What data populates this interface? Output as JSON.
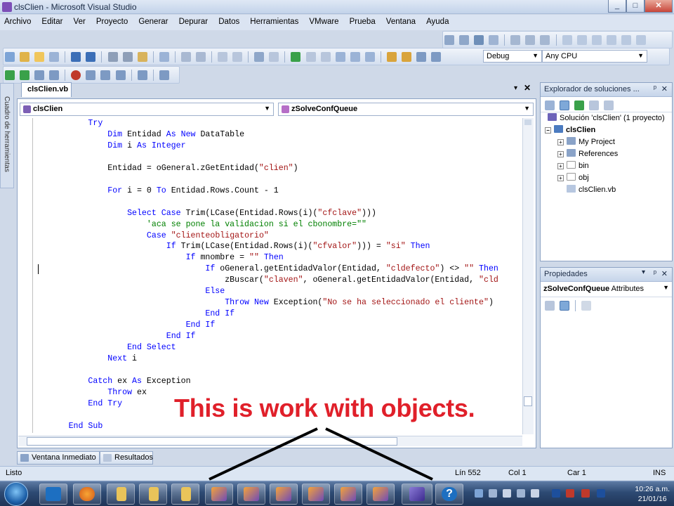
{
  "window": {
    "title": "clsClien - Microsoft Visual Studio",
    "min": "_",
    "max": "□",
    "close": "✕"
  },
  "menu": [
    "Archivo",
    "Editar",
    "Ver",
    "Proyecto",
    "Generar",
    "Depurar",
    "Datos",
    "Herramientas",
    "VMware",
    "Prueba",
    "Ventana",
    "Ayuda"
  ],
  "toolbar": {
    "config": "Debug",
    "platform": "Any CPU"
  },
  "sidestrip_label": "Cuadro de herramientas",
  "editor": {
    "tab": "clsClien.vb",
    "class_combo": "clsClien",
    "member_combo": "zSolveConfQueue",
    "lines": [
      {
        "indent": "        ",
        "parts": [
          {
            "t": "Try",
            "c": "kw"
          }
        ]
      },
      {
        "indent": "            ",
        "parts": [
          {
            "t": "Dim",
            "c": "kw"
          },
          {
            "t": " Entidad ",
            "c": ""
          },
          {
            "t": "As New",
            "c": "kw"
          },
          {
            "t": " DataTable",
            "c": ""
          }
        ]
      },
      {
        "indent": "            ",
        "parts": [
          {
            "t": "Dim",
            "c": "kw"
          },
          {
            "t": " i ",
            "c": ""
          },
          {
            "t": "As Integer",
            "c": "kw"
          }
        ]
      },
      {
        "indent": "",
        "parts": []
      },
      {
        "indent": "            ",
        "parts": [
          {
            "t": "Entidad = oGeneral.zGetEntidad(",
            "c": ""
          },
          {
            "t": "\"clien\"",
            "c": "st"
          },
          {
            "t": ")",
            "c": ""
          }
        ]
      },
      {
        "indent": "",
        "parts": []
      },
      {
        "indent": "            ",
        "parts": [
          {
            "t": "For",
            "c": "kw"
          },
          {
            "t": " i = 0 ",
            "c": ""
          },
          {
            "t": "To",
            "c": "kw"
          },
          {
            "t": " Entidad.Rows.Count - 1",
            "c": ""
          }
        ]
      },
      {
        "indent": "",
        "parts": []
      },
      {
        "indent": "                ",
        "parts": [
          {
            "t": "Select Case",
            "c": "kw"
          },
          {
            "t": " Trim(LCase(Entidad.Rows(i)(",
            "c": ""
          },
          {
            "t": "\"cfclave\"",
            "c": "st"
          },
          {
            "t": ")))",
            "c": ""
          }
        ]
      },
      {
        "indent": "                    ",
        "parts": [
          {
            "t": "'aca se pone la validacion si el cbonombre=\"\"",
            "c": "cm"
          }
        ]
      },
      {
        "indent": "                    ",
        "parts": [
          {
            "t": "Case",
            "c": "kw"
          },
          {
            "t": " ",
            "c": ""
          },
          {
            "t": "\"clienteobligatorio\"",
            "c": "st"
          }
        ]
      },
      {
        "indent": "                        ",
        "parts": [
          {
            "t": "If",
            "c": "kw"
          },
          {
            "t": " Trim(LCase(Entidad.Rows(i)(",
            "c": ""
          },
          {
            "t": "\"cfvalor\"",
            "c": "st"
          },
          {
            "t": "))) = ",
            "c": ""
          },
          {
            "t": "\"si\"",
            "c": "st"
          },
          {
            "t": " ",
            "c": ""
          },
          {
            "t": "Then",
            "c": "kw"
          }
        ]
      },
      {
        "indent": "                            ",
        "parts": [
          {
            "t": "If",
            "c": "kw"
          },
          {
            "t": " mnombre = ",
            "c": ""
          },
          {
            "t": "\"\"",
            "c": "st"
          },
          {
            "t": " ",
            "c": ""
          },
          {
            "t": "Then",
            "c": "kw"
          }
        ]
      },
      {
        "indent": "                                ",
        "parts": [
          {
            "t": "If",
            "c": "kw"
          },
          {
            "t": " oGeneral.getEntidadValor(Entidad, ",
            "c": ""
          },
          {
            "t": "\"cldefecto\"",
            "c": "st"
          },
          {
            "t": ") <> ",
            "c": ""
          },
          {
            "t": "\"\"",
            "c": "st"
          },
          {
            "t": " ",
            "c": ""
          },
          {
            "t": "Then",
            "c": "kw"
          }
        ]
      },
      {
        "indent": "                                    ",
        "parts": [
          {
            "t": "zBuscar(",
            "c": ""
          },
          {
            "t": "\"claven\"",
            "c": "st"
          },
          {
            "t": ", oGeneral.getEntidadValor(Entidad, ",
            "c": ""
          },
          {
            "t": "\"cld",
            "c": "st"
          }
        ]
      },
      {
        "indent": "                                ",
        "parts": [
          {
            "t": "Else",
            "c": "kw"
          }
        ]
      },
      {
        "indent": "                                    ",
        "parts": [
          {
            "t": "Throw New",
            "c": "kw"
          },
          {
            "t": " Exception(",
            "c": ""
          },
          {
            "t": "\"No se ha seleccionado el cliente\"",
            "c": "st"
          },
          {
            "t": ")",
            "c": ""
          }
        ]
      },
      {
        "indent": "                                ",
        "parts": [
          {
            "t": "End If",
            "c": "kw"
          }
        ]
      },
      {
        "indent": "                            ",
        "parts": [
          {
            "t": "End If",
            "c": "kw"
          }
        ]
      },
      {
        "indent": "                        ",
        "parts": [
          {
            "t": "End If",
            "c": "kw"
          }
        ]
      },
      {
        "indent": "                ",
        "parts": [
          {
            "t": "End Select",
            "c": "kw"
          }
        ]
      },
      {
        "indent": "            ",
        "parts": [
          {
            "t": "Next",
            "c": "kw"
          },
          {
            "t": " i",
            "c": ""
          }
        ]
      },
      {
        "indent": "",
        "parts": []
      },
      {
        "indent": "        ",
        "parts": [
          {
            "t": "Catch",
            "c": "kw"
          },
          {
            "t": " ex ",
            "c": ""
          },
          {
            "t": "As",
            "c": "kw"
          },
          {
            "t": " Exception",
            "c": ""
          }
        ]
      },
      {
        "indent": "            ",
        "parts": [
          {
            "t": "Throw",
            "c": "kw"
          },
          {
            "t": " ex",
            "c": ""
          }
        ]
      },
      {
        "indent": "        ",
        "parts": [
          {
            "t": "End Try",
            "c": "kw"
          }
        ]
      },
      {
        "indent": "",
        "parts": []
      },
      {
        "indent": "    ",
        "parts": [
          {
            "t": "End Sub",
            "c": "kw"
          }
        ]
      }
    ]
  },
  "solution_explorer": {
    "title": "Explorador de soluciones ...",
    "pin": "ᵖ",
    "close": "✕",
    "solution": "Solución 'clsClien' (1 proyecto)",
    "project": "clsClien",
    "items": [
      "My Project",
      "References",
      "bin",
      "obj",
      "clsClien.vb"
    ]
  },
  "properties": {
    "title": "Propiedades",
    "object": "zSolveConfQueue",
    "object_type": "Attributes"
  },
  "bottom_tabs": [
    "Ventana Inmediato",
    "Resultados"
  ],
  "status": {
    "state": "Listo",
    "line": "Lín 552",
    "col": "Col 1",
    "char": "Car 1",
    "mode": "INS"
  },
  "annotation": "This is work with objects.",
  "clock": {
    "time": "10:26 a.m.",
    "date": "21/01/16"
  },
  "colors": {
    "keyword": "#0000ff",
    "string": "#a31515",
    "comment": "#008000",
    "annotation": "#e0202a"
  },
  "icons": [
    "windows-start-icon",
    "hyper-v-icon",
    "firefox-icon",
    "folder-icon",
    "visual-studio-icon",
    "help-icon"
  ]
}
